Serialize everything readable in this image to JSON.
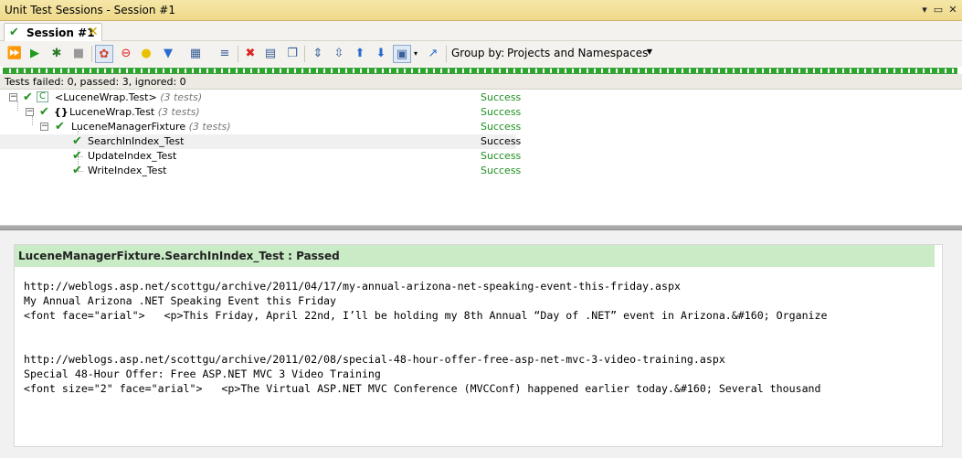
{
  "window": {
    "title": "Unit Test Sessions - Session #1"
  },
  "tab": {
    "label": "Session #1"
  },
  "toolbar": {
    "group_by_label": "Group by:",
    "group_by_value": "Projects and Namespaces"
  },
  "status": {
    "text": "Tests failed: 0, passed: 3, ignored: 0"
  },
  "tree": [
    {
      "name": "<LuceneWrap.Test>",
      "count": "(3 tests)",
      "result": "Success"
    },
    {
      "name": "LuceneWrap.Test",
      "count": "(3 tests)",
      "result": "Success"
    },
    {
      "name": "LuceneManagerFixture",
      "count": "(3 tests)",
      "result": "Success"
    },
    {
      "name": "SearchInIndex_Test",
      "count": "",
      "result": "Success"
    },
    {
      "name": "UpdateIndex_Test",
      "count": "",
      "result": "Success"
    },
    {
      "name": "WriteIndex_Test",
      "count": "",
      "result": "Success"
    }
  ],
  "output": {
    "header": "LuceneManagerFixture.SearchInIndex_Test : Passed",
    "lines": [
      "http://weblogs.asp.net/scottgu/archive/2011/04/17/my-annual-arizona-net-speaking-event-this-friday.aspx",
      "My Annual Arizona .NET Speaking Event this Friday",
      "<font face=\"arial\">   <p>This Friday, April 22nd, I’ll be holding my 8th Annual “Day of .NET” event in Arizona.&#160; Organize",
      "",
      "",
      "http://weblogs.asp.net/scottgu/archive/2011/02/08/special-48-hour-offer-free-asp-net-mvc-3-video-training.aspx",
      "Special 48-Hour Offer: Free ASP.NET MVC 3 Video Training",
      "<font size=\"2\" face=\"arial\">   <p>The Virtual ASP.NET MVC Conference (MVCConf) happened earlier today.&#160; Several thousand"
    ]
  }
}
